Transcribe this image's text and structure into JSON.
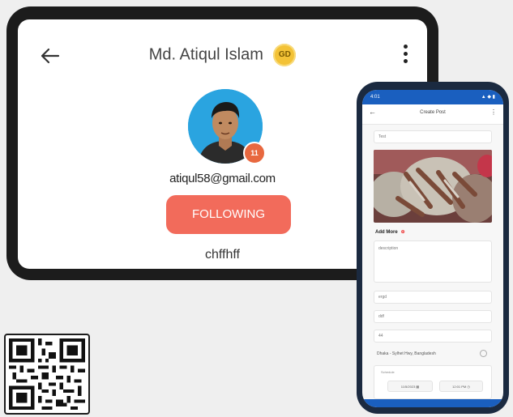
{
  "profile": {
    "name": "Md. Atiqul Islam",
    "badge_text": "GD",
    "avatar_badge_text": "11",
    "email": "atiqul58@gmail.com",
    "follow_button_label": "FOLLOWING",
    "bio": "chffhff"
  },
  "phone": {
    "status_time": "4:01",
    "status_right": "▲ ◆ ▮",
    "screen_title": "Create Post",
    "title_input_value": "Test",
    "add_more_label": "Add More",
    "description_placeholder": "description",
    "field1_value": "ergd",
    "field2_value": "ddf",
    "field3_value": "44",
    "location_value": "Dhaka - Sylhet Hwy, Bangladesh",
    "schedule_label": "Schedule",
    "schedule_date": "11/5/2023",
    "schedule_time": "12:01 PM"
  },
  "colors": {
    "follow_button": "#f26b5b",
    "badge_gold": "#f3c236",
    "phone_accent": "#1a5fbf",
    "avatar_bg": "#2aa4e0"
  },
  "icons": {
    "back": "arrow-left",
    "menu": "more-vertical",
    "add": "plus",
    "location": "target",
    "calendar": "calendar"
  }
}
